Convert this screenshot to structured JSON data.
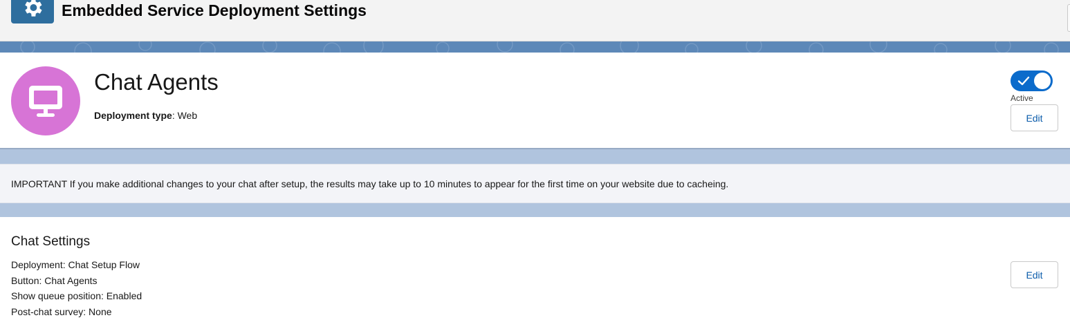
{
  "header": {
    "title": "Embedded Service Deployment Settings",
    "icon": "gear-icon",
    "icon_color": "#2e6e9e"
  },
  "record": {
    "name": "Chat Agents",
    "avatar_icon": "desktop-icon",
    "avatar_color": "#d774d6",
    "deployment_type_label": "Deployment type",
    "deployment_type_value": ": Web",
    "status_label": "Active",
    "status_active": true,
    "edit_label": "Edit"
  },
  "notice": {
    "text": "IMPORTANT If you make additional changes to your chat after setup, the results may take up to 10 minutes to appear for the first time on your website due to cacheing."
  },
  "chat_settings": {
    "title": "Chat Settings",
    "items": [
      "Deployment: Chat Setup Flow",
      "Button: Chat Agents",
      "Show queue position: Enabled",
      "Post-chat survey: None"
    ],
    "edit_label": "Edit"
  },
  "colors": {
    "accent": "#0b6bcb",
    "link": "#0b5cab",
    "band": "#5d88b8",
    "background": "#b0c4de"
  }
}
